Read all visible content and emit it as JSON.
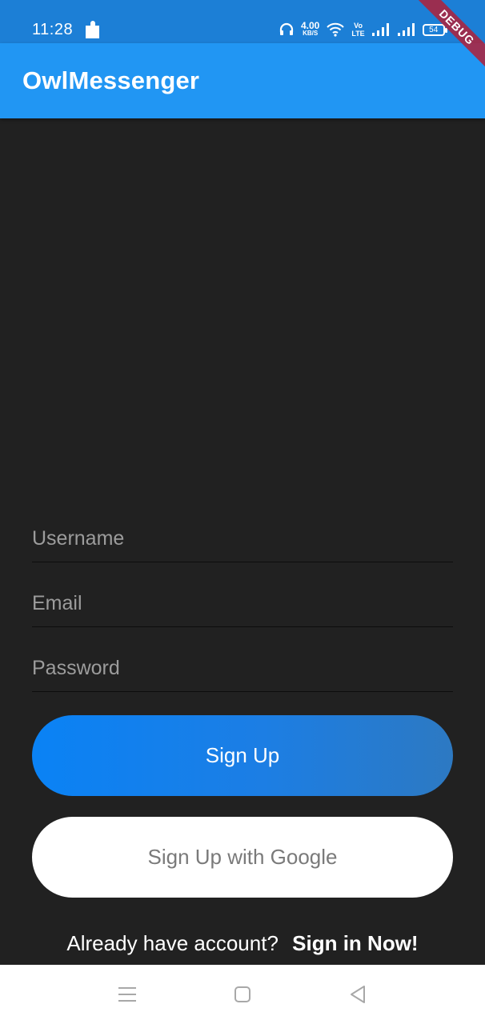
{
  "status_bar": {
    "time": "11:28",
    "network_speed_value": "4.00",
    "network_speed_unit": "KB/S",
    "volte_top": "Vo",
    "volte_bottom": "LTE",
    "battery": "54",
    "icons": [
      "puzzle-icon",
      "headphones-icon",
      "wifi-icon",
      "volte-icon",
      "signal-icon",
      "signal-icon",
      "battery-icon"
    ]
  },
  "debug_banner": "DEBUG",
  "app_bar": {
    "title": "OwlMessenger"
  },
  "form": {
    "username_placeholder": "Username",
    "email_placeholder": "Email",
    "password_placeholder": "Password",
    "signup_label": "Sign Up",
    "google_label": "Sign Up with Google",
    "have_account_text": "Already have account?",
    "signin_link": "Sign in Now!"
  },
  "nav_bar": {
    "icons": [
      "menu-icon",
      "home-square-icon",
      "back-triangle-icon"
    ]
  },
  "colors": {
    "status_bar": "#1c7fd6",
    "app_bar": "#2196f3",
    "background": "#212121",
    "signup_gradient_start": "#0a82f5",
    "signup_gradient_end": "#2d79c2",
    "google_button": "#ffffff",
    "nav_bar": "#ffffff",
    "debug_ribbon": "#b02038"
  }
}
